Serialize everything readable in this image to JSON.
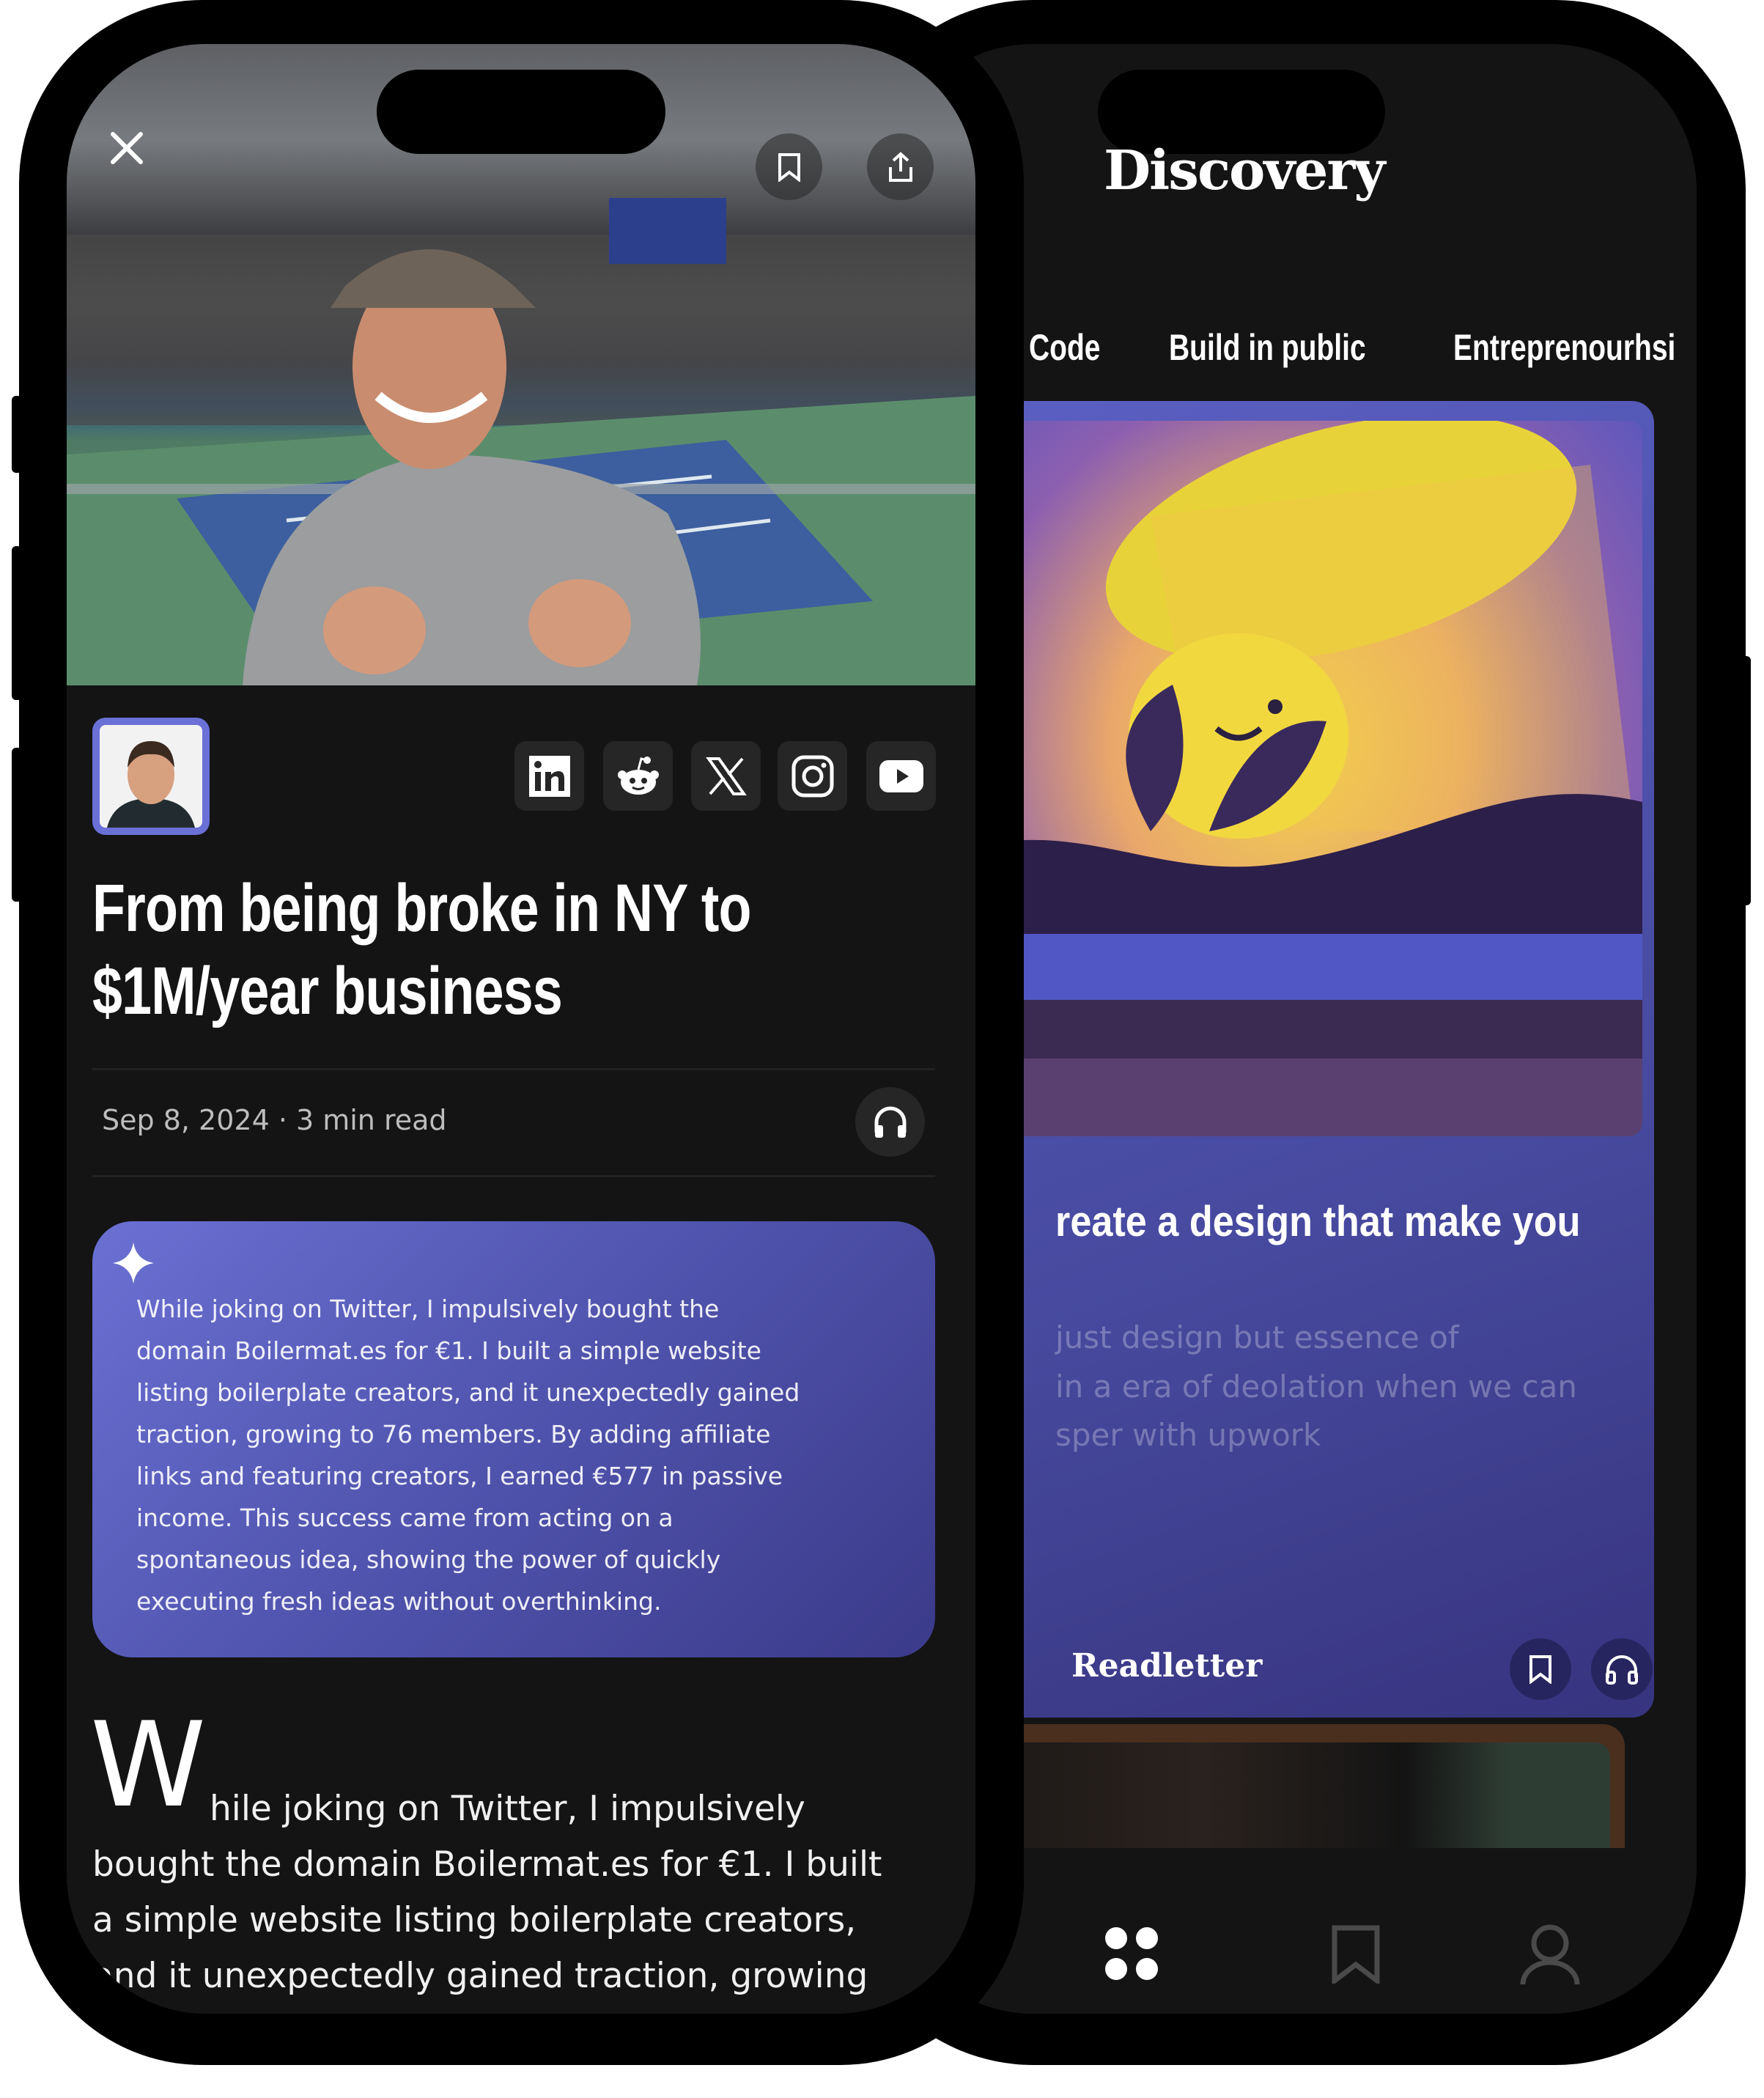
{
  "discovery_screen": {
    "title": "Discovery",
    "tabs": [
      "Code",
      "Build in public",
      "Entreprenourhsi"
    ],
    "card": {
      "title": "reate a design that make you",
      "description_lines": [
        "just design but essence of",
        "in a era of deolation when we can",
        "sper with upwork"
      ],
      "source": "Readletter",
      "bookmark_icon": "bookmark-icon",
      "listen_icon": "headphones-icon"
    },
    "nav": [
      {
        "icon": "grid-icon",
        "active": true
      },
      {
        "icon": "bookmark-icon",
        "active": false
      },
      {
        "icon": "user-icon",
        "active": false
      }
    ]
  },
  "article_screen": {
    "hero_actions": [
      "close-icon",
      "bookmark-icon",
      "share-icon"
    ],
    "socials": [
      "linkedin",
      "reddit",
      "x",
      "instagram",
      "youtube"
    ],
    "title_lines": [
      "From being broke in NY to",
      "$1M/year business"
    ],
    "meta": "Sep 8, 2024 · 3 min read",
    "summary_lines": [
      "While joking on Twitter, I impulsively bought the",
      "domain Boilermat.es for €1. I built a simple website",
      "listing boilerplate creators, and it unexpectedly gained",
      "traction, growing to 76 members. By adding affiliate",
      "links and featuring creators, I earned €577 in passive",
      "income. This success came from acting on a",
      "spontaneous idea, showing the power of quickly",
      "executing fresh ideas without overthinking."
    ],
    "body": {
      "drop_cap": "W",
      "lines": [
        "hile joking on Twitter, I impulsively",
        "bought the domain Boilermat.es for €1. I built",
        "a simple website listing boilerplate creators,",
        "and it unexpectedly gained traction, growing"
      ]
    }
  },
  "colors": {
    "accent": "#6b70d6",
    "background": "#141414",
    "card_dark": "#37347f"
  }
}
